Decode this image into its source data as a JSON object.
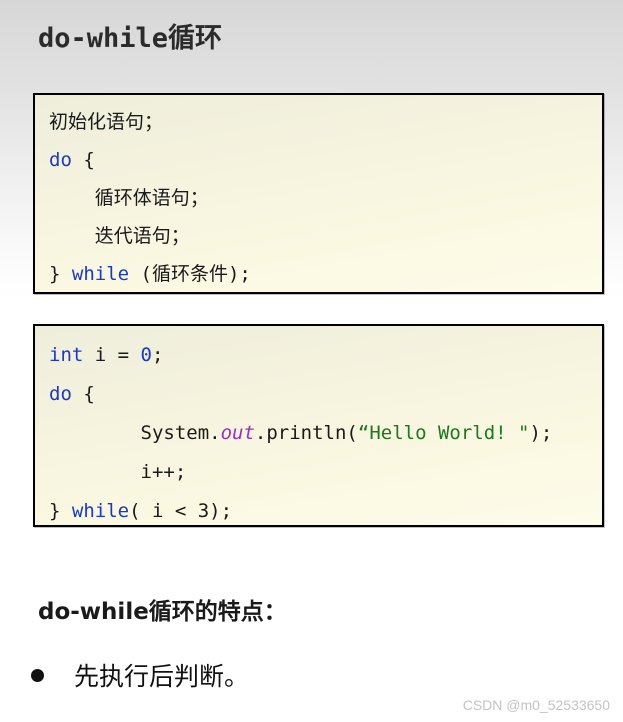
{
  "slide": {
    "title": "do-while循环",
    "watermark": "CSDN @m0_52533650"
  },
  "code_block_syntax": {
    "code_background": "#faf8e0",
    "border_color": "#000000",
    "keyword_color": "#1a39c8",
    "string_color": "#197a19",
    "field_color": "#9b2fc4",
    "plain_color": "#1a1a1a"
  },
  "code_block_1": {
    "name": "do-while-syntax-template",
    "lines": [
      {
        "indent": "",
        "tokens": [
          {
            "t": "初始化语句；",
            "c": "plain"
          }
        ]
      },
      {
        "indent": "",
        "tokens": [
          {
            "t": "do",
            "c": "kw"
          },
          {
            "t": " {",
            "c": "plain"
          }
        ]
      },
      {
        "indent": "    ",
        "tokens": [
          {
            "t": "循环体语句；",
            "c": "plain"
          }
        ]
      },
      {
        "indent": "    ",
        "tokens": [
          {
            "t": "迭代语句；",
            "c": "plain"
          }
        ]
      },
      {
        "indent": "",
        "tokens": [
          {
            "t": "} ",
            "c": "plain"
          },
          {
            "t": "while",
            "c": "kw"
          },
          {
            "t": " (循环条件);",
            "c": "plain"
          }
        ]
      }
    ]
  },
  "code_block_2": {
    "name": "do-while-java-example",
    "lines": [
      {
        "indent": "",
        "tokens": [
          {
            "t": "int",
            "c": "kw"
          },
          {
            "t": " i = ",
            "c": "plain"
          },
          {
            "t": "0",
            "c": "num"
          },
          {
            "t": ";",
            "c": "plain"
          }
        ]
      },
      {
        "indent": "",
        "tokens": [
          {
            "t": "do",
            "c": "kw"
          },
          {
            "t": " {",
            "c": "plain"
          }
        ]
      },
      {
        "indent": "        ",
        "tokens": [
          {
            "t": "System.",
            "c": "plain"
          },
          {
            "t": "out",
            "c": "fld"
          },
          {
            "t": ".println(",
            "c": "plain"
          },
          {
            "t": "“Hello World! \"",
            "c": "str"
          },
          {
            "t": ");",
            "c": "plain"
          }
        ]
      },
      {
        "indent": "        ",
        "tokens": [
          {
            "t": "i++;",
            "c": "plain"
          }
        ]
      },
      {
        "indent": "",
        "tokens": [
          {
            "t": "} ",
            "c": "plain"
          },
          {
            "t": "while",
            "c": "kw"
          },
          {
            "t": "( i < 3);",
            "c": "plain"
          }
        ]
      }
    ]
  },
  "features": {
    "heading": "do-while循环的特点：",
    "bullets": [
      {
        "marker": "●",
        "text": "先执行后判断。"
      }
    ]
  }
}
